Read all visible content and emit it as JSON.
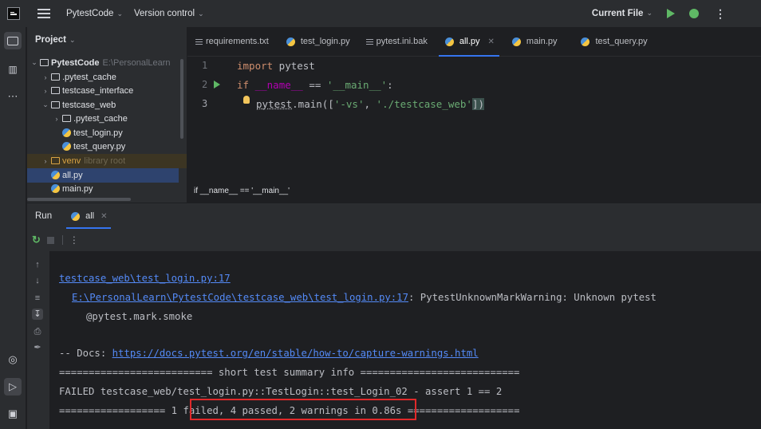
{
  "titlebar": {
    "project_name": "PytestCode",
    "vcs_menu": "Version control",
    "run_config": "Current File"
  },
  "project_panel": {
    "title": "Project",
    "tree": [
      {
        "label": "PytestCode",
        "extra": "E:\\PersonalLearn"
      },
      {
        "label": ".pytest_cache"
      },
      {
        "label": "testcase_interface"
      },
      {
        "label": "testcase_web"
      },
      {
        "label": ".pytest_cache"
      },
      {
        "label": "test_login.py"
      },
      {
        "label": "test_query.py"
      },
      {
        "label": "venv",
        "extra": "library root"
      },
      {
        "label": "all.py"
      },
      {
        "label": "main.py"
      }
    ]
  },
  "editor": {
    "tabs": [
      {
        "label": "requirements.txt"
      },
      {
        "label": "test_login.py"
      },
      {
        "label": "pytest.ini.bak"
      },
      {
        "label": "all.py"
      },
      {
        "label": "main.py"
      },
      {
        "label": "test_query.py"
      }
    ],
    "line_numbers": [
      "1",
      "2",
      "3"
    ],
    "code": {
      "l1_kw": "import",
      "l1_rest": " pytest",
      "l2_kw": "if",
      "l2_name": " __name__",
      "l2_op": " == ",
      "l2_str": "'__main__'",
      "l2_colon": ":",
      "l3_pre": "pytest",
      "l3_mid": ".main([",
      "l3_s1": "'-vs'",
      "l3_comma": ", ",
      "l3_s2": "'./testcase_web'",
      "l3_end": "])"
    },
    "breadcrumb": "if __name__ == '__main__'"
  },
  "run_panel": {
    "title": "Run",
    "tab_label": "all",
    "console": {
      "line1": "testcase_web\\test_login.py:17",
      "line2_link": "E:\\PersonalLearn\\PytestCode\\testcase_web\\test_login.py:17",
      "line2_rest": ": PytestUnknownMarkWarning: Unknown pytest",
      "line3": "@pytest.mark.smoke",
      "line4_prefix": "-- Docs: ",
      "line4_link": "https://docs.pytest.org/en/stable/how-to/capture-warnings.html",
      "line5": "========================== short test summary info ===========================",
      "line6": "FAILED testcase_web/test_login.py::TestLogin::test_Login_02 - assert 1 == 2",
      "line7_prefix": "==================",
      "line7_summary": " 1 failed, 4 passed, 2 warnings ",
      "line7_suffix": "in 0.86s ==================="
    }
  },
  "colors": {
    "accent": "#3574f0",
    "highlight_box": "#e0292a",
    "run_green": "#5fb865"
  }
}
